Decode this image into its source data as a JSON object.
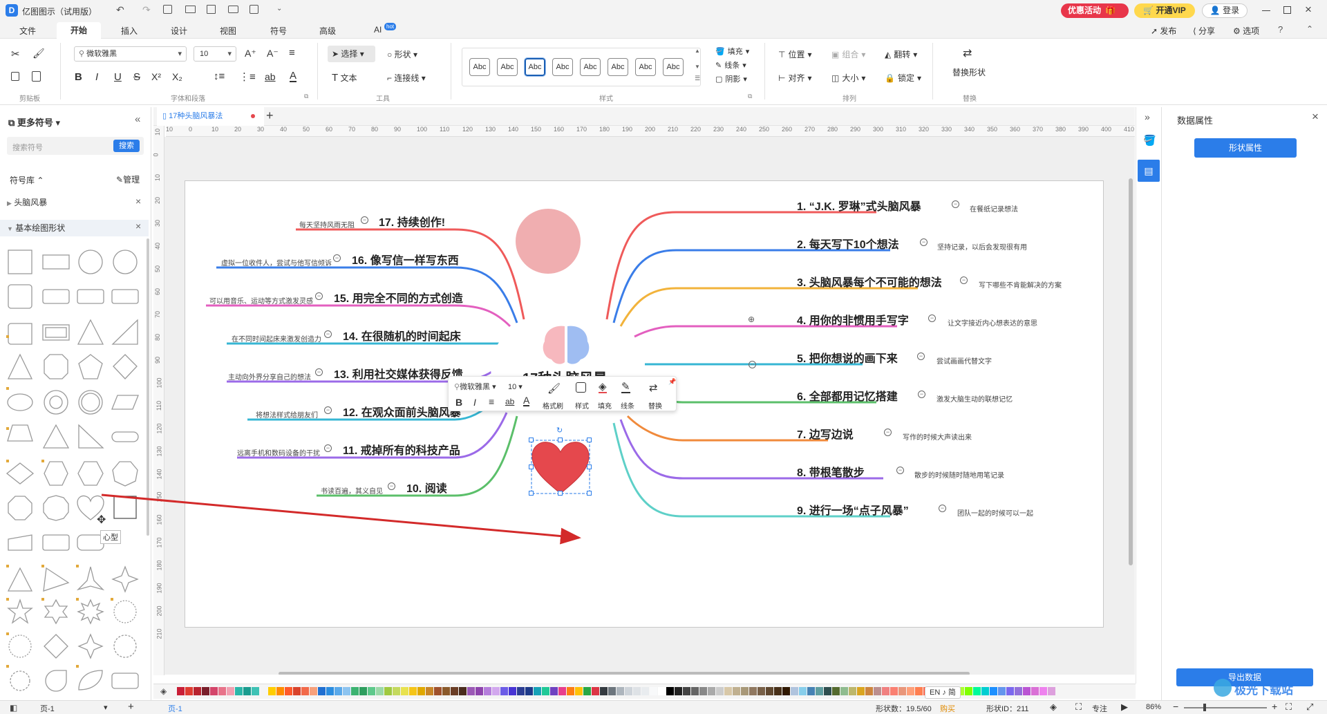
{
  "app": {
    "title": "亿图图示（试用版）",
    "promo": "优惠活动",
    "vip": "开通VIP",
    "login": "登录"
  },
  "menu": {
    "tabs": [
      "文件",
      "开始",
      "插入",
      "设计",
      "视图",
      "符号",
      "高级",
      "AI"
    ],
    "ai_badge": "hot",
    "publish": "发布",
    "share": "分享",
    "options": "选项"
  },
  "ribbon": {
    "font_name": "微软雅黑",
    "font_size": "10",
    "select": "选择",
    "shape": "形状",
    "text": "文本",
    "connector": "连接线",
    "style_sample": "Abc",
    "fill": "填充",
    "line": "线条",
    "shadow": "阴影",
    "position": "位置",
    "combine": "组合",
    "flip": "翻转",
    "align": "对齐",
    "size": "大小",
    "lock": "锁定",
    "replace_shape": "替换形状",
    "groups": [
      "剪贴板",
      "字体和段落",
      "工具",
      "样式",
      "排列",
      "替换"
    ]
  },
  "leftpanel": {
    "title": "更多符号",
    "search_placeholder": "搜索符号",
    "search_btn": "搜索",
    "library": "符号库",
    "manage": "管理",
    "lib1": "头脑风暴",
    "lib2": "基本绘图形状",
    "tooltip": "心型"
  },
  "document": {
    "tab": "17种头脑风暴法"
  },
  "ruler": {
    "h": [
      "10",
      "0",
      "10",
      "20",
      "30",
      "40",
      "50",
      "60",
      "70",
      "80",
      "90",
      "100",
      "110",
      "120",
      "130",
      "140",
      "150",
      "160",
      "170",
      "180",
      "190",
      "200",
      "210",
      "220",
      "230",
      "240",
      "250",
      "260",
      "270",
      "280",
      "290",
      "300",
      "310",
      "320",
      "330",
      "340",
      "350",
      "360",
      "370",
      "380",
      "390",
      "400",
      "410"
    ],
    "v": [
      "10",
      "0",
      "10",
      "20",
      "30",
      "40",
      "50",
      "60",
      "70",
      "80",
      "90",
      "100",
      "110",
      "120",
      "130",
      "140",
      "150",
      "160",
      "170",
      "180",
      "190",
      "200",
      "210"
    ]
  },
  "mindmap": {
    "center_partial": "17种头脑风暴法",
    "right": [
      {
        "label": "1. “J.K. 罗琳”式头脑风暴",
        "note": "在餐纸记录想法"
      },
      {
        "label": "2. 每天写下10个想法",
        "note": "坚持记录，以后会发现很有用"
      },
      {
        "label": "3. 头脑风暴每个不可能的想法",
        "note": "写下哪些不肯能解决的方案"
      },
      {
        "label": "4. 用你的非惯用手写字",
        "note": "让文字接近内心想表达的意思"
      },
      {
        "label": "5. 把你想说的画下来",
        "note": "尝试画画代替文字"
      },
      {
        "label": "6. 全部都用记忆搭建",
        "note": "激发大脑生动的联想记忆"
      },
      {
        "label": "7. 边写边说",
        "note": "写作的时候大声读出来"
      },
      {
        "label": "8. 带根笔散步",
        "note": "散步的时候随时随地用笔记录"
      },
      {
        "label": "9. 进行一场“点子风暴”",
        "note": "团队一起的时候可以一起"
      }
    ],
    "left": [
      {
        "label": "17. 持续创作!",
        "note": "每天坚持风雨无阻"
      },
      {
        "label": "16. 像写信一样写东西",
        "note": "虚拟一位收件人，尝试与他写信倾诉"
      },
      {
        "label": "15. 用完全不同的方式创造",
        "note": "可以用音乐、运动等方式激发灵感"
      },
      {
        "label": "14. 在很随机的时间起床",
        "note": "在不同时间起床来激发创造力"
      },
      {
        "label": "13. 利用社交媒体获得反馈",
        "note": "主动向外界分享自己的想法"
      },
      {
        "label": "12. 在观众面前头脑风暴",
        "note": "将想法样式给朋友们"
      },
      {
        "label": "11. 戒掉所有的科技产品",
        "note": "远离手机和数码设备的干扰"
      },
      {
        "label": "10. 阅读",
        "note": "书读百遍，其义自见"
      }
    ]
  },
  "floatbar": {
    "font": "微软雅黑",
    "size": "10",
    "format_painter": "格式刷",
    "style": "样式",
    "fill": "填充",
    "line": "线条",
    "replace": "替换"
  },
  "rightpanel": {
    "title": "数据属性",
    "shape_props": "形状属性",
    "export": "导出数据"
  },
  "statusbar": {
    "page": "页-1",
    "page_tab": "页-1",
    "shape_count": "形状数：19.5/60",
    "buy": "购买",
    "shape_id": "形状ID：211",
    "focus": "专注",
    "zoom": "86%",
    "ime": "EN ♪ 简"
  },
  "colors": {
    "accent": "#2b7de9",
    "heart": "#e5484d",
    "pink_circle": "#f0aeb0",
    "promo": "#e8364a"
  },
  "watermark": "极光下载站"
}
